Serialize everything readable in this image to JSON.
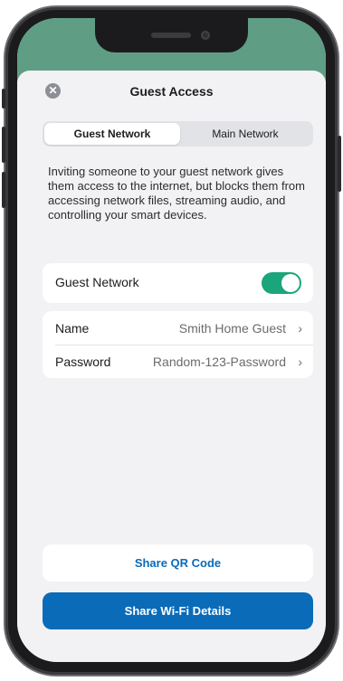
{
  "colors": {
    "accent": "#0a6bb8",
    "toggle_on": "#1aa57a",
    "status_area": "#5f9d85",
    "sheet_background": "#f2f2f4"
  },
  "header": {
    "close_icon": "close-icon",
    "title": "Guest Access"
  },
  "tabs": [
    {
      "label": "Guest Network",
      "selected": true
    },
    {
      "label": "Main Network",
      "selected": false
    }
  ],
  "description": "Inviting someone to your guest network gives them access to the internet, but blocks them from accessing network files, streaming audio, and controlling your smart devices.",
  "guest_toggle": {
    "label": "Guest Network",
    "enabled": true
  },
  "network_details": [
    {
      "label": "Name",
      "value": "Smith Home Guest",
      "icon": "chevron-right-icon"
    },
    {
      "label": "Password",
      "value": "Random-123-Password",
      "icon": "chevron-right-icon"
    }
  ],
  "actions": {
    "share_qr_label": "Share QR Code",
    "share_wifi_label": "Share Wi-Fi Details"
  }
}
